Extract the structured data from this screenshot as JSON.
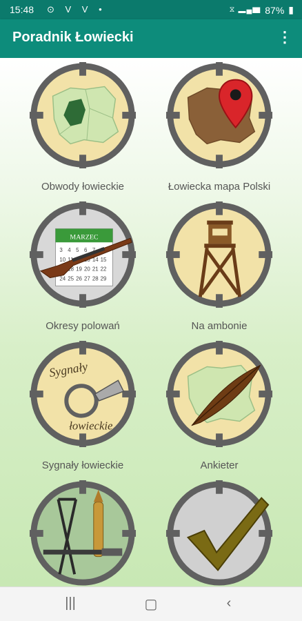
{
  "status": {
    "time": "15:48",
    "notifications": "⊙ V V •",
    "battery": "87%"
  },
  "app": {
    "title": "Poradnik Łowiecki"
  },
  "tiles": [
    {
      "label": "Obwody łowieckie",
      "icon": "poland-map-region-icon"
    },
    {
      "label": "Łowiecka mapa Polski",
      "icon": "map-pin-poland-icon"
    },
    {
      "label": "Okresy polowań",
      "icon": "calendar-rifle-icon",
      "calendar_month": "MARZEC"
    },
    {
      "label": "Na ambonie",
      "icon": "hunting-stand-icon"
    },
    {
      "label": "Sygnały łowieckie",
      "icon": "hunting-horn-icon",
      "text_top": "Sygnały",
      "text_bottom": "łowieckie"
    },
    {
      "label": "Ankieter",
      "icon": "feather-quill-icon"
    },
    {
      "label": "",
      "icon": "hunting-gear-icon"
    },
    {
      "label": "",
      "icon": "checkmark-icon"
    }
  ],
  "colors": {
    "status_bar": "#0b7a6c",
    "app_bar": "#0d8c7b",
    "ring": "#606060",
    "tile_fill": "#f2e2a8"
  }
}
